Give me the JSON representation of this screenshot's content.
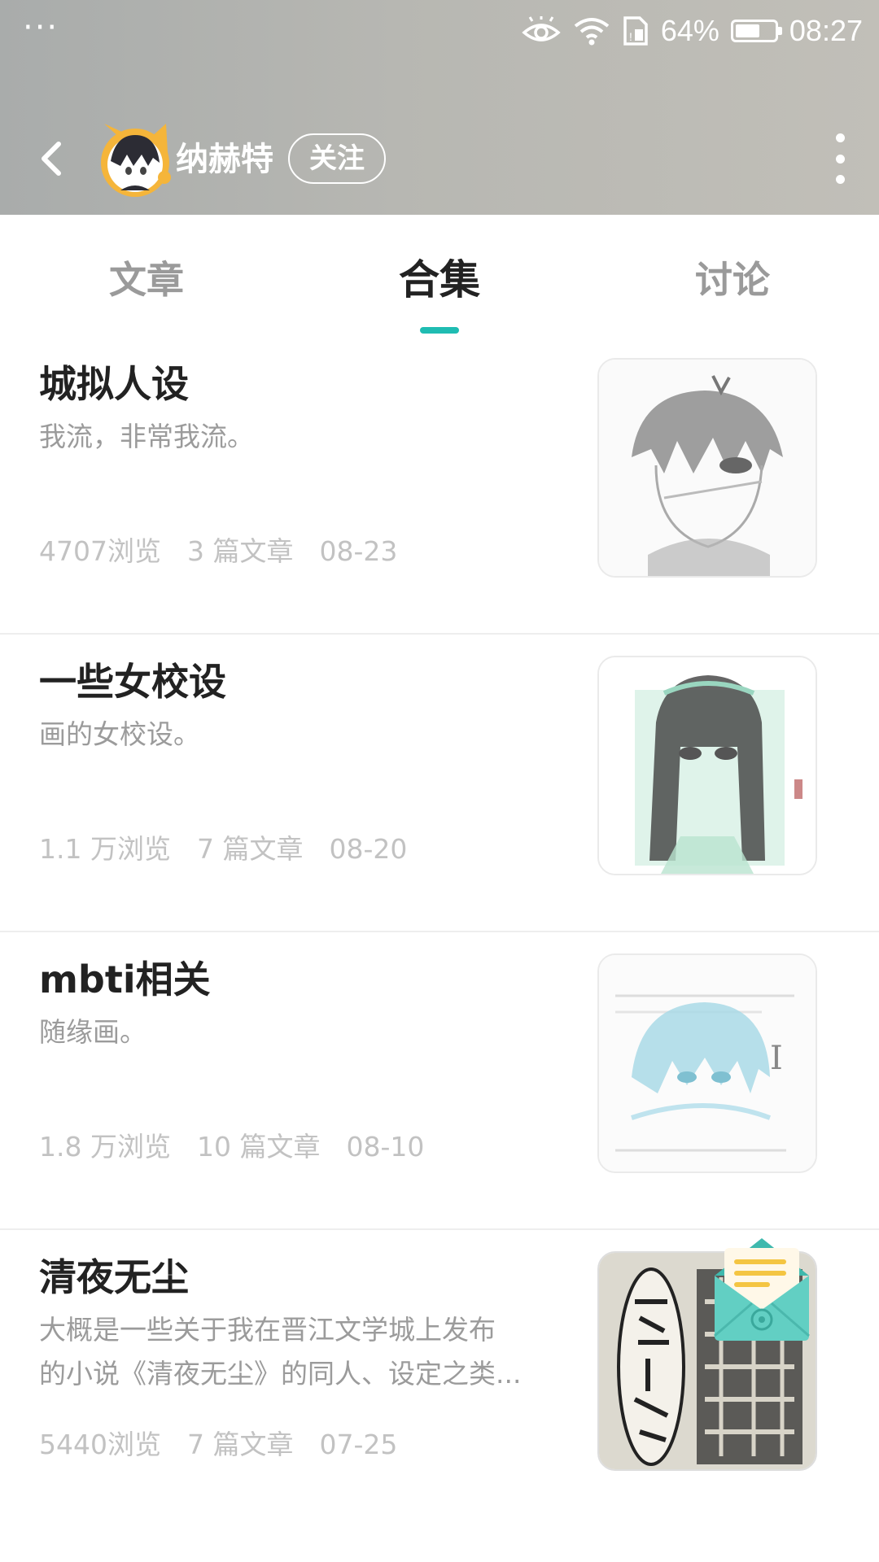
{
  "status_bar": {
    "left_dots": "···",
    "battery_text": "64%",
    "battery_level": 0.64,
    "time": "08:27",
    "icons": [
      "eye-comfort-icon",
      "wifi-icon",
      "sim-icon",
      "battery-icon"
    ]
  },
  "header": {
    "username": "纳赫特",
    "follow_label": "关注"
  },
  "tabs": [
    {
      "label": "文章",
      "active": false
    },
    {
      "label": "合集",
      "active": true
    },
    {
      "label": "讨论",
      "active": false
    }
  ],
  "accent_color": "#1fbcb2",
  "collections": [
    {
      "title": "城拟人设",
      "desc": [
        "我流，非常我流。"
      ],
      "views": "4707浏览",
      "articles": "3 篇文章",
      "date": "08-23"
    },
    {
      "title": "一些女校设",
      "desc": [
        "画的女校设。"
      ],
      "views": "1.1 万浏览",
      "articles": "7 篇文章",
      "date": "08-20"
    },
    {
      "title": "mbti相关",
      "desc": [
        "随缘画。"
      ],
      "views": "1.8 万浏览",
      "articles": "10 篇文章",
      "date": "08-10"
    },
    {
      "title": "清夜无尘",
      "desc": [
        "大概是一些关于我在晋江文学城上发布",
        "的小说《清夜无尘》的同人、设定之类..."
      ],
      "views": "5440浏览",
      "articles": "7 篇文章",
      "date": "07-25"
    }
  ]
}
